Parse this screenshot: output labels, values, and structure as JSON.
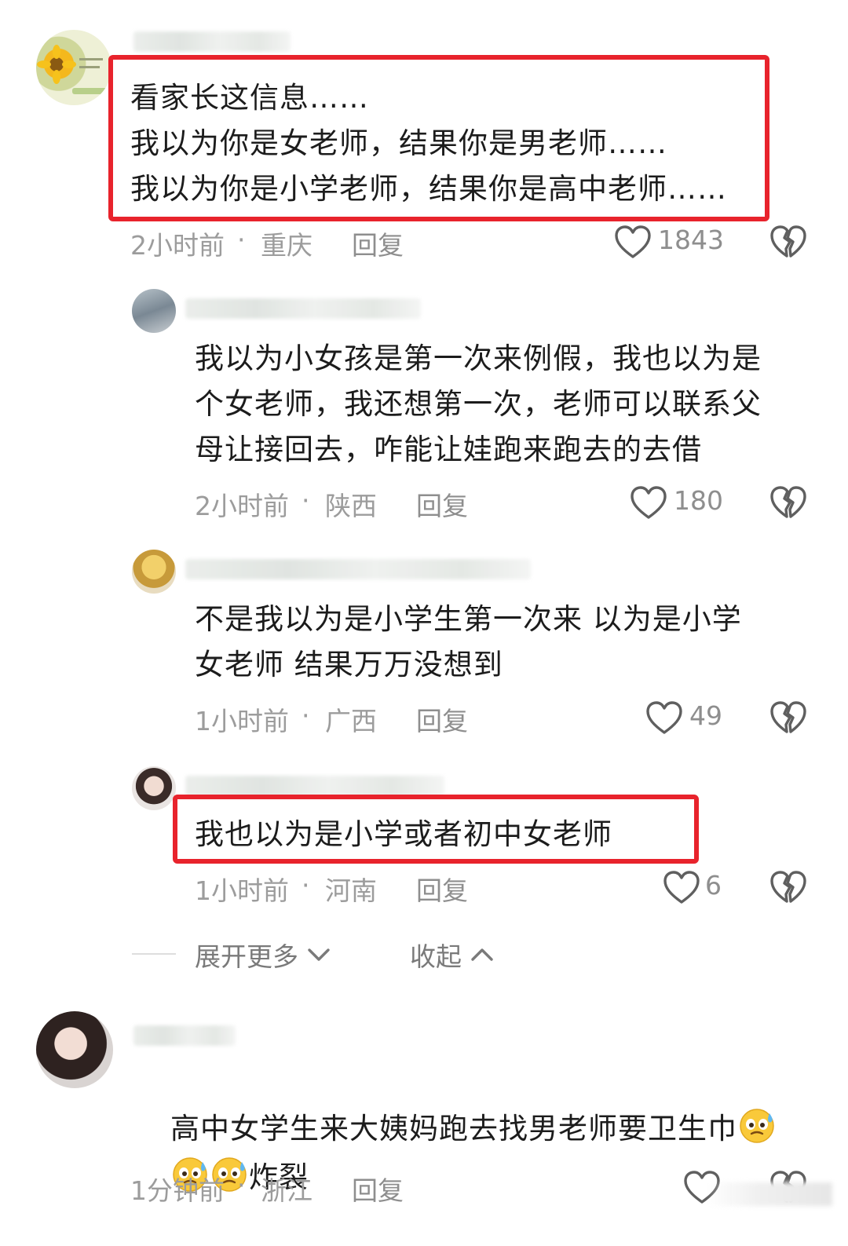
{
  "comments": [
    {
      "lines": [
        "看家长这信息……",
        "我以为你是女老师，结果你是男老师……",
        "我以为你是小学老师，结果你是高中老师……"
      ],
      "time": "2小时前",
      "location": "重庆",
      "reply": "回复",
      "likes": "1843"
    },
    {
      "lines": [
        "我以为小女孩是第一次来例假，我也以为是",
        "个女老师，我还想第一次，老师可以联系父",
        "母让接回去，咋能让娃跑来跑去的去借"
      ],
      "time": "2小时前",
      "location": "陕西",
      "reply": "回复",
      "likes": "180"
    },
    {
      "lines": [
        "不是我以为是小学生第一次来 以为是小学",
        "女老师 结果万万没想到"
      ],
      "time": "1小时前",
      "location": "广西",
      "reply": "回复",
      "likes": "49"
    },
    {
      "lines": [
        "我也以为是小学或者初中女老师"
      ],
      "time": "1小时前",
      "location": "河南",
      "reply": "回复",
      "likes": "6"
    },
    {
      "line1": "高中女学生来大姨妈跑去找男老师要卫生巾",
      "line2": "炸裂",
      "time": "1分钟前",
      "location": "浙江",
      "reply": "回复"
    }
  ],
  "thread": {
    "expand_more": "展开更多",
    "collapse": "收起"
  },
  "separator": "·",
  "accent_color": "#e8232c",
  "icons": [
    "heart-icon",
    "dislike-heart-icon",
    "chevron-down-icon",
    "chevron-up-icon",
    "sweat-emoji-icon"
  ]
}
